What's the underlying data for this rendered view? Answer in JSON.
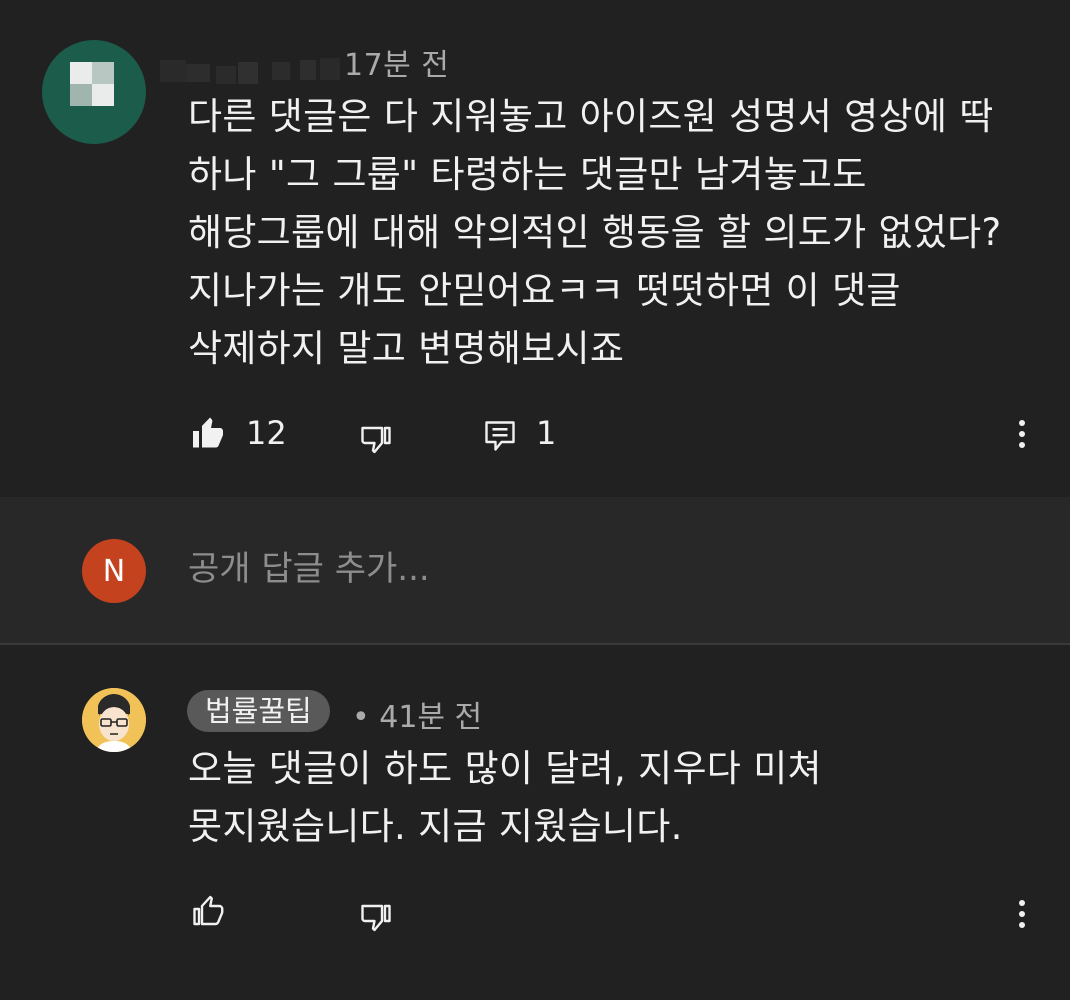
{
  "top_comment": {
    "time": "17분 전",
    "text_lines": [
      "다른 댓글은 다 지워놓고 아이즈원 성명서 영상에 딱",
      "하나 \"그 그룹\" 타령하는 댓글만 남겨놓고도",
      "해당그룹에 대해 악의적인 행동을 할 의도가 없었다?",
      "지나가는 개도 안믿어요ㅋㅋ 떳떳하면 이 댓글",
      "삭제하지 말고 변명해보시죠"
    ],
    "like_count": "12",
    "reply_count": "1",
    "like_icon": "thumbs-up-filled-icon",
    "dislike_icon": "thumbs-down-outline-icon",
    "reply_icon": "comment-icon",
    "menu_icon": "more-vertical-icon",
    "avatar_color": "#1c5c4a"
  },
  "reply_bar": {
    "avatar_letter": "N",
    "avatar_color": "#c5421f",
    "placeholder": "공개 답글 추가..."
  },
  "second_comment": {
    "author": "법률꿀팁",
    "time": "• 41분 전",
    "text_lines": [
      "오늘 댓글이 하도 많이 달려, 지우다 미쳐",
      "못지웠습니다. 지금 지웠습니다."
    ],
    "like_icon": "thumbs-up-outline-icon",
    "dislike_icon": "thumbs-down-outline-icon",
    "menu_icon": "more-vertical-icon",
    "avatar_color": "#f1c257"
  },
  "colors": {
    "background": "#212121",
    "reply_bar_background": "#282828",
    "text_primary": "#f1f1f1",
    "text_secondary": "#aaaaaa",
    "badge_background": "#595959"
  }
}
